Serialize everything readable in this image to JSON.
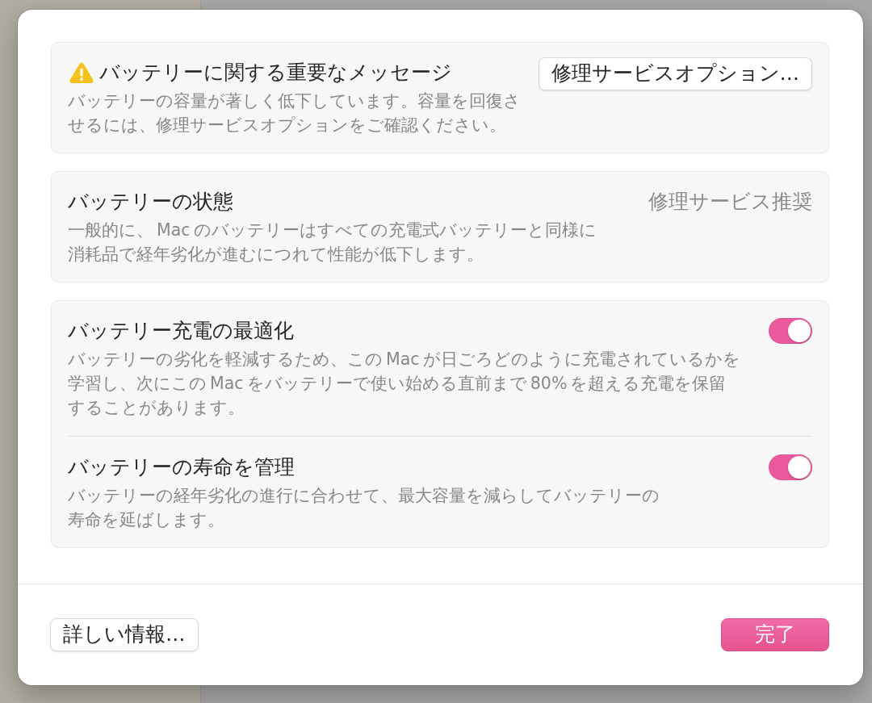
{
  "dialog": {
    "cards": [
      {
        "kind": "alert",
        "title": "バッテリーに関する重要なメッセージ",
        "description": "バッテリーの容量が著しく低下しています。容量を回復させるには、修理サービスオプションをご確認ください。",
        "button": "修理サービスオプション…"
      },
      {
        "kind": "status",
        "title": "バッテリーの状態",
        "value": "修理サービス推奨",
        "description": "一般的に、Macのバッテリーはすべての充電式バッテリーと同様に消耗品で経年劣化が進むにつれて性能が低下します。"
      },
      {
        "kind": "toggles",
        "rows": [
          {
            "title": "バッテリー充電の最適化",
            "description": "バッテリーの劣化を軽減するため、このMacが日ごろどのように充電されているかを学習し、次にこのMacをバッテリーで使い始める直前まで80%を超える充電を保留することがあります。",
            "on": true
          },
          {
            "title": "バッテリーの寿命を管理",
            "description": "バッテリーの経年劣化の進行に合わせて、最大容量を減らしてバッテリーの寿命を延ばします。",
            "on": true
          }
        ]
      }
    ],
    "footer": {
      "help_button": "詳しい情報…",
      "done_button": "完了"
    }
  }
}
